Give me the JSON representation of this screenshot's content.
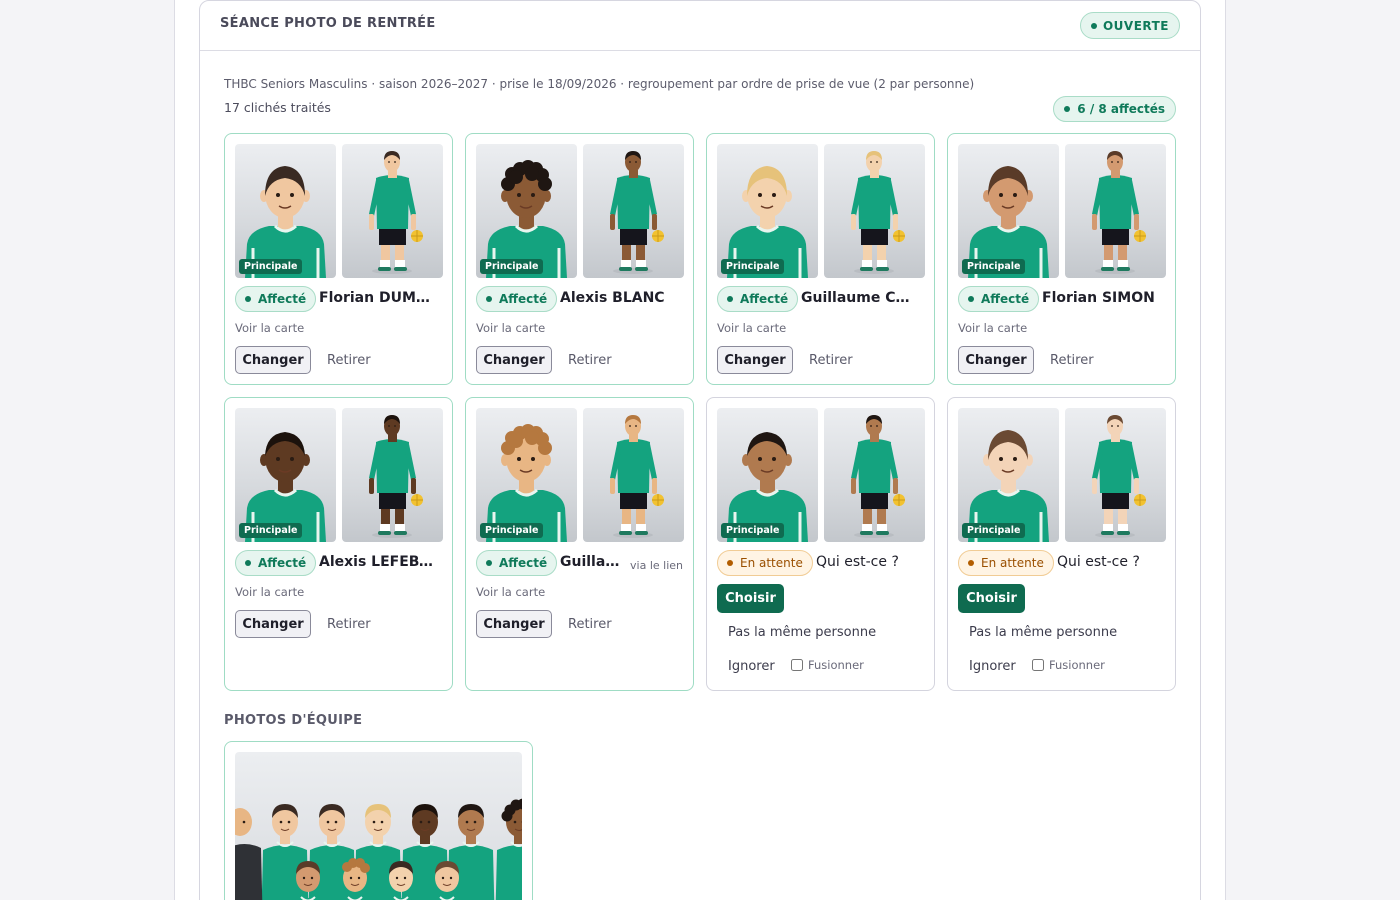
{
  "session": {
    "title": "SÉANCE PHOTO DE RENTRÉE",
    "status": "OUVERTE",
    "meta": "THBC Seniors Masculins · saison 2026–2027 · prise le 18/09/2026 · regroupement par ordre de prise de vue (2 par personne)",
    "count": "17 clichés traités",
    "assigned_summary": "6  /  8  affectés"
  },
  "labels": {
    "principal": "Principale",
    "assigned": "Affecté",
    "pending": "En attente",
    "see_card": "Voir la carte",
    "change": "Changer",
    "remove": "Retirer",
    "choose": "Choisir",
    "not_same": "Pas la même personne",
    "ignore": "Ignorer",
    "merge": "Fusionner"
  },
  "cards": [
    {
      "status": "assigned",
      "name": "Florian DUMONT",
      "via": ""
    },
    {
      "status": "assigned",
      "name": "Alexis BLANC",
      "via": ""
    },
    {
      "status": "assigned",
      "name": "Guillaume CHEV...",
      "via": ""
    },
    {
      "status": "assigned",
      "name": "Florian SIMON",
      "via": ""
    },
    {
      "status": "assigned",
      "name": "Alexis LEFEBVRE",
      "via": ""
    },
    {
      "status": "assigned",
      "name": "Guillau...",
      "via": "via le lien"
    },
    {
      "status": "pending",
      "name": "Qui est-ce ?",
      "via": ""
    },
    {
      "status": "pending",
      "name": "Qui est-ce ?",
      "via": ""
    }
  ],
  "team_section": {
    "title": "PHOTOS D'ÉQUIPE"
  },
  "colors": {
    "accent": "#0f6b50",
    "jersey": "#14a37f",
    "assigned_border": "#9fdcc4",
    "pending": "#9a4f00"
  }
}
